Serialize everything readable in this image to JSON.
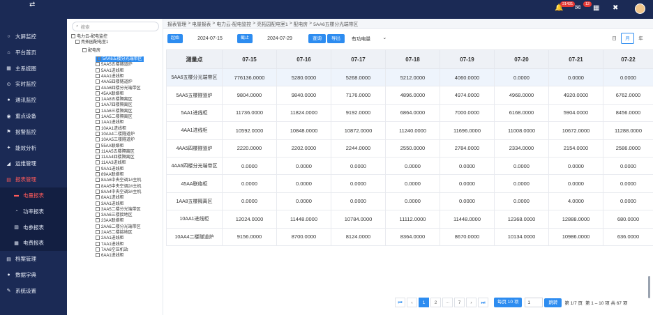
{
  "topbar": {
    "toggle_glyph": "⇄",
    "badge_1": "31431",
    "badge_2": "12"
  },
  "sidebar": {
    "items": [
      {
        "label": "大屏监控",
        "icon": "dashboard-icon",
        "glyph": "○"
      },
      {
        "label": "平台首页",
        "icon": "home-icon",
        "glyph": "⌂"
      },
      {
        "label": "主系统图",
        "icon": "diagram-icon",
        "glyph": "▦"
      },
      {
        "label": "实时监控",
        "icon": "monitor-icon",
        "glyph": "⊙"
      },
      {
        "label": "通讯监控",
        "icon": "signal-icon",
        "glyph": "●"
      },
      {
        "label": "重点设备",
        "icon": "device-icon",
        "glyph": "◉"
      },
      {
        "label": "报警监控",
        "icon": "flag-icon",
        "glyph": "⚑"
      },
      {
        "label": "能效分析",
        "icon": "pin-icon",
        "glyph": "✦"
      },
      {
        "label": "运维管理",
        "icon": "tool-icon",
        "glyph": "◢"
      },
      {
        "label": "报表管理",
        "icon": "report-icon",
        "glyph": "▤"
      }
    ],
    "subitems": [
      {
        "label": "电量报表",
        "icon": "energy-report-icon",
        "glyph": "▬"
      },
      {
        "label": "功率报表",
        "icon": "power-report-icon",
        "glyph": "◔"
      },
      {
        "label": "电参报表",
        "icon": "param-report-icon",
        "glyph": "▥"
      },
      {
        "label": "电费报表",
        "icon": "bill-report-icon",
        "glyph": "▦"
      }
    ],
    "items_after": [
      {
        "label": "档案管理",
        "icon": "archive-icon",
        "glyph": "▤"
      },
      {
        "label": "数据字典",
        "icon": "dict-icon",
        "glyph": "●"
      },
      {
        "label": "系统设置",
        "icon": "settings-icon",
        "glyph": "✎"
      }
    ]
  },
  "tree": {
    "search_placeholder": "搜索",
    "root": "电力云-配电监控",
    "level1": "亮拓园配电室1",
    "level2": "配电房",
    "leaves": [
      "5AA6五楼分光端带区",
      "5AA5五楼隧道炉",
      "5AA1进线柜",
      "4AA1进线柜",
      "4AA5四楼隧道炉",
      "4AA6四楼分光端带区",
      "45AA联络柜",
      "1AA8五楼隔离区",
      "1AA7四楼隔离区",
      "1AA6三楼隔离区",
      "1AA5二楼隔离区",
      "1AA1进线柜",
      "10AA1进线柜",
      "10AA4二楼隧道炉",
      "10AA5三楼隧道炉",
      "55AA联络柜",
      "11AA5五楼隔离区",
      "11AA4四楼隔离区",
      "11AA3进线柜",
      "9AA1进线柜",
      "89AA联络柜",
      "8AA6中央空调1#主机",
      "8AA5中央空调2#主机",
      "8AA4中央空调3#主机",
      "8AA1进线柜",
      "3AA1进线柜",
      "3AA5二楼分光端带区",
      "3AA6三楼接地区",
      "23AA联络柜",
      "2AA6二楼分光端带区",
      "2AA5二楼接地区",
      "2AA1进线柜",
      "7AA1进线柜",
      "7AA6空压机站",
      "6AA1进线柜"
    ]
  },
  "breadcrumb": [
    "报表管理",
    "电量报表",
    "电力云-配电监控",
    "亮拓园配电室1",
    "配电房",
    "5AA6五楼分光端带区"
  ],
  "filter": {
    "start_label": "起始",
    "start_date": "2024-07-15",
    "end_label": "截止",
    "end_date": "2024-07-29",
    "query": "查询",
    "export": "导出",
    "type_value": "有功电量",
    "type_arrow": "⌄"
  },
  "period_tabs": [
    "日",
    "月",
    "年"
  ],
  "table": {
    "columns": [
      "测量点",
      "07-15",
      "07-16",
      "07-17",
      "07-18",
      "07-19",
      "07-20",
      "07-21",
      "07-22"
    ],
    "rows": [
      [
        "5AA6五楼分光端带区",
        "776136.0000",
        "5280.0000",
        "5268.0000",
        "5212.0000",
        "4060.0000",
        "0.0000",
        "0.0000",
        "0.0000"
      ],
      [
        "5AA5五楼隧道炉",
        "9804.0000",
        "9840.0000",
        "7176.0000",
        "4896.0000",
        "4974.0000",
        "4968.0000",
        "4920.0000",
        "6762.0000"
      ],
      [
        "5AA1进线柜",
        "11736.0000",
        "11824.0000",
        "9192.0000",
        "6864.0000",
        "7000.0000",
        "6168.0000",
        "5904.0000",
        "8456.0000"
      ],
      [
        "4AA1进线柜",
        "10592.0000",
        "10848.0000",
        "10872.0000",
        "11240.0000",
        "11696.0000",
        "11008.0000",
        "10672.0000",
        "11288.0000"
      ],
      [
        "4AA5四楼隧道炉",
        "2220.0000",
        "2202.0000",
        "2244.0000",
        "2550.0000",
        "2784.0000",
        "2334.0000",
        "2154.0000",
        "2586.0000"
      ],
      [
        "4AA6四楼分光端带区",
        "0.0000",
        "0.0000",
        "0.0000",
        "0.0000",
        "0.0000",
        "0.0000",
        "0.0000",
        "0.0000"
      ],
      [
        "45AA联络柜",
        "0.0000",
        "0.0000",
        "0.0000",
        "0.0000",
        "0.0000",
        "0.0000",
        "0.0000",
        "0.0000"
      ],
      [
        "1AA8五楼隔离区",
        "0.0000",
        "0.0000",
        "0.0000",
        "0.0000",
        "0.0000",
        "0.0000",
        "4.0000",
        "0.0000"
      ],
      [
        "10AA1进线柜",
        "12024.0000",
        "11448.0000",
        "10784.0000",
        "11112.0000",
        "11448.0000",
        "12368.0000",
        "12888.0000",
        "680.0000"
      ],
      [
        "10AA4二楼隧道炉",
        "9156.0000",
        "8700.0000",
        "8124.0000",
        "8364.0000",
        "8670.0000",
        "10134.0000",
        "10986.0000",
        "636.0000"
      ]
    ]
  },
  "pager": {
    "first": "⏮",
    "prev": "‹",
    "p1": "1",
    "p2": "2",
    "ellipsis": "···",
    "p7": "7",
    "next": "›",
    "last": "⏭",
    "size_label": "每页 10 项",
    "jump_value": "1",
    "jump_btn": "跳转",
    "page_info": "第 1/7 页",
    "range_info": "第 1 – 10 项 共 67 项"
  },
  "colors": {
    "nav_bg": "#1b2a55",
    "accent": "#2d8cf0",
    "active": "#ff5a5a"
  }
}
